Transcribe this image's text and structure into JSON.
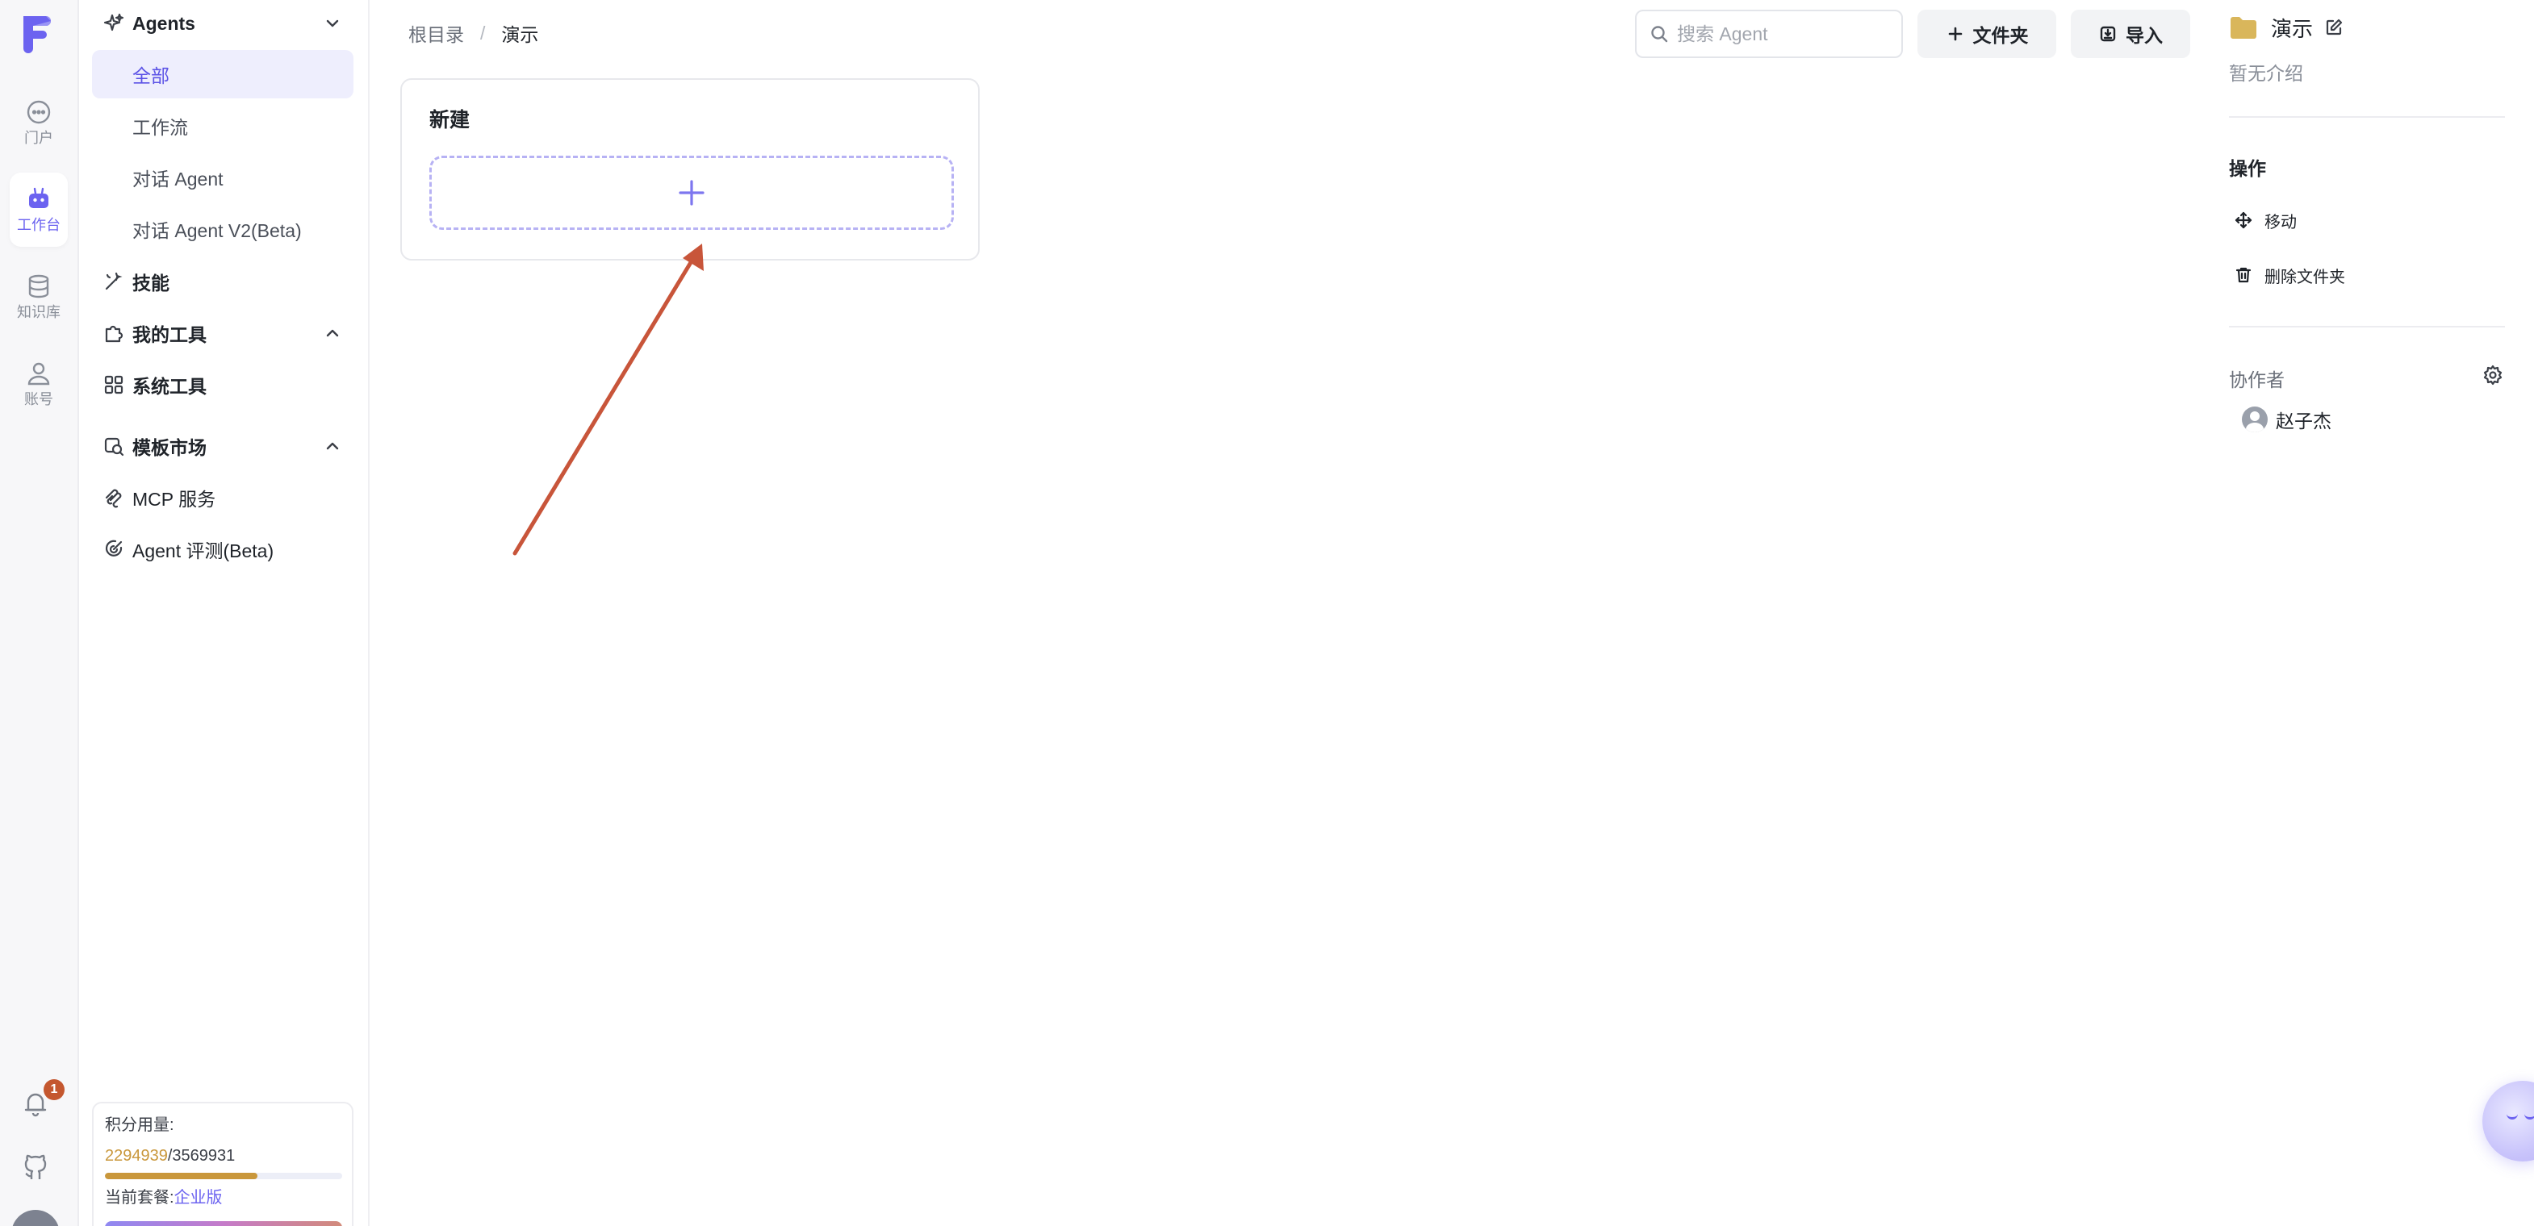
{
  "rail": {
    "items": [
      {
        "label": "门户",
        "icon": "chat-bubble-icon"
      },
      {
        "label": "工作台",
        "icon": "robot-icon",
        "active": true
      },
      {
        "label": "知识库",
        "icon": "database-icon"
      },
      {
        "label": "账号",
        "icon": "user-icon"
      }
    ],
    "notification_count": "1"
  },
  "nav": {
    "agents": {
      "label": "Agents",
      "icon": "sparkle-icon"
    },
    "sub_items": [
      "全部",
      "工作流",
      "对话 Agent",
      "对话 Agent V2(Beta)"
    ],
    "skills": {
      "label": "技能",
      "icon": "wand-icon"
    },
    "my_tools": {
      "label": "我的工具",
      "icon": "puzzle-icon"
    },
    "system_tools": {
      "label": "系统工具",
      "icon": "grid-icon"
    },
    "template_market": {
      "label": "模板市场",
      "icon": "store-icon"
    },
    "mcp": {
      "label": "MCP 服务",
      "icon": "mcp-icon"
    },
    "evaluation": {
      "label": "Agent 评测(Beta)",
      "icon": "target-icon"
    }
  },
  "quota": {
    "title": "积分用量:",
    "used": "2294939",
    "total": "/3569931",
    "fraction_used": 0.643,
    "plan_label": "当前套餐:",
    "plan_name": "企业版"
  },
  "breadcrumb": {
    "root": "根目录",
    "separator": "/",
    "current": "演示"
  },
  "toolbar": {
    "search_placeholder": "搜索 Agent",
    "folder_button": "文件夹",
    "import_button": "导入"
  },
  "card": {
    "title": "新建"
  },
  "right_panel": {
    "folder_name": "演示",
    "description": "暂无介绍",
    "ops_title": "操作",
    "ops": [
      "移动",
      "删除文件夹"
    ],
    "collaborators_title": "协作者",
    "collaborators": [
      "赵子杰"
    ]
  },
  "colors": {
    "accent": "#6c63f0",
    "quota": "#c9973b",
    "annotation_arrow": "#c8553a",
    "folder": "#d9b65b"
  }
}
